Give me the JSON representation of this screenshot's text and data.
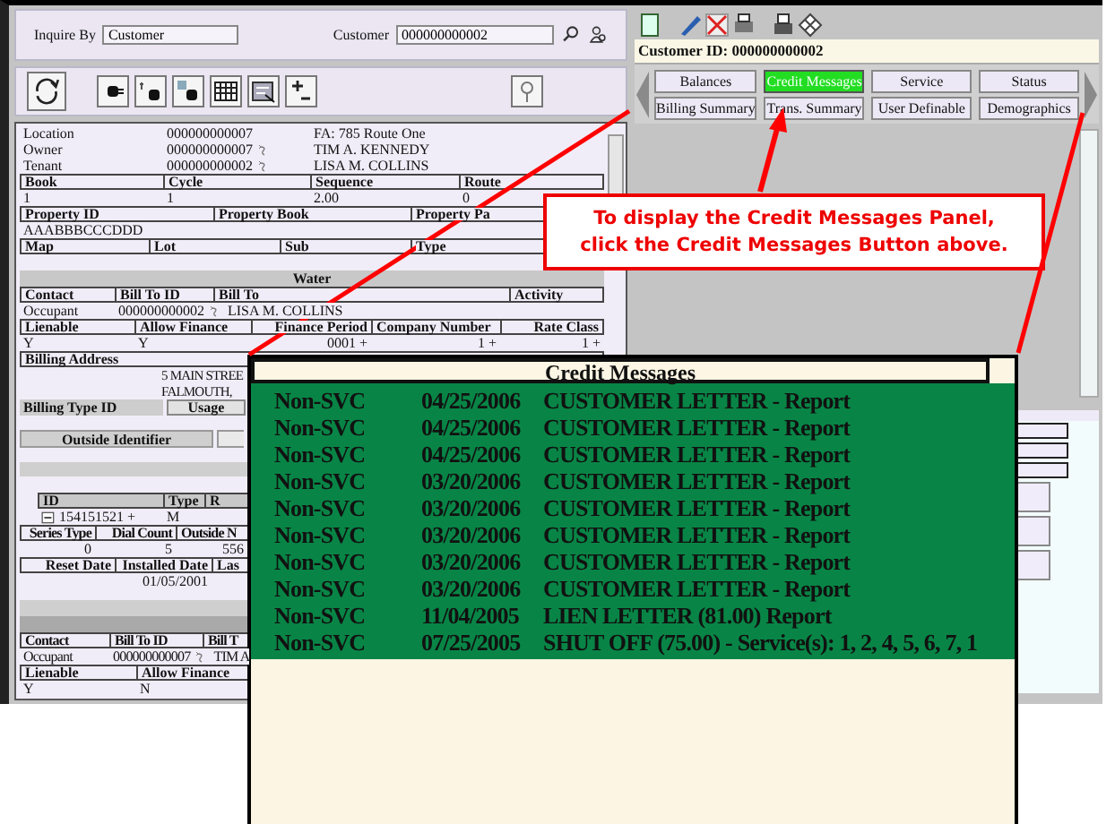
{
  "inquiry": {
    "label": "Inquire By",
    "value": "Customer",
    "customer_label": "Customer",
    "customer_value": "000000000002"
  },
  "left_rows": [
    {
      "kind": "info",
      "cells": [
        {
          "text": "Location"
        },
        {
          "text": "000000000007"
        },
        {
          "text": "FA: 785 Route One"
        }
      ]
    },
    {
      "kind": "info",
      "cells": [
        {
          "text": "Owner"
        },
        {
          "text": "000000000007",
          "kind": "lookup"
        },
        {
          "text": "TIM A. KENNEDY"
        }
      ]
    },
    {
      "kind": "info",
      "cells": [
        {
          "text": "Tenant"
        },
        {
          "text": "000000000002",
          "kind": "lookup"
        },
        {
          "text": "LISA M. COLLINS"
        }
      ]
    },
    {
      "kind": "header",
      "cells": [
        {
          "text": "Book"
        },
        {
          "text": "Cycle"
        },
        {
          "text": "Sequence"
        },
        {
          "text": "Route"
        }
      ]
    },
    {
      "kind": "values",
      "cells": [
        {
          "text": "1"
        },
        {
          "text": "1"
        },
        {
          "text": "2.00"
        },
        {
          "text": "0"
        }
      ]
    },
    {
      "kind": "header",
      "cells": [
        {
          "text": "Property ID"
        },
        {
          "text": "Property Book"
        },
        {
          "text": "Property Pa"
        }
      ]
    },
    {
      "kind": "values",
      "cells": [
        {
          "text": "AAABBBCCCDDD"
        }
      ]
    },
    {
      "kind": "header",
      "cells": [
        {
          "text": "Map"
        },
        {
          "text": "Lot"
        },
        {
          "text": "Sub"
        },
        {
          "text": "Type"
        }
      ]
    },
    {
      "kind": "section",
      "cells": [
        {
          "text": "Water"
        }
      ]
    },
    {
      "kind": "header",
      "cells": [
        {
          "text": "Contact"
        },
        {
          "text": "Bill To ID"
        },
        {
          "text": "Bill To"
        },
        {
          "text": "Activity"
        }
      ]
    },
    {
      "kind": "values",
      "cells": [
        {
          "text": "Occupant"
        },
        {
          "text": "000000000002",
          "kind": "lookup"
        },
        {
          "text": "LISA M. COLLINS"
        }
      ]
    },
    {
      "kind": "header",
      "cells": [
        {
          "text": "Lienable"
        },
        {
          "text": "Allow Finance"
        },
        {
          "text": "Finance Period"
        },
        {
          "text": "Company Number"
        },
        {
          "text": "Rate Class"
        }
      ]
    },
    {
      "kind": "values",
      "cells": [
        {
          "text": "Y"
        },
        {
          "text": "Y"
        },
        {
          "text": "0001 +"
        },
        {
          "text": "1 +"
        },
        {
          "text": "1 +"
        }
      ]
    },
    {
      "kind": "header",
      "cells": [
        {
          "text": "Billing Address"
        }
      ]
    },
    {
      "kind": "address",
      "cells": [
        {
          "text": "5 MAIN STREE"
        },
        {
          "text": "FALMOUTH,"
        }
      ]
    },
    {
      "kind": "labeled",
      "cells": [
        {
          "text": "Billing Type ID"
        },
        {
          "text": "Usage"
        }
      ]
    },
    {
      "kind": "section_left",
      "cells": [
        {
          "text": "Outside Identifier"
        }
      ]
    },
    {
      "kind": "bar"
    },
    {
      "kind": "header",
      "cells": [
        {
          "text": "ID"
        },
        {
          "text": "Type"
        },
        {
          "text": "R"
        }
      ]
    },
    {
      "kind": "values",
      "cells": [
        {
          "text": "154151521 +",
          "kind": "expander"
        },
        {
          "text": "M"
        }
      ]
    },
    {
      "kind": "header",
      "cells": [
        {
          "text": "Series Type"
        },
        {
          "text": "Dial Count"
        },
        {
          "text": "Outside N"
        }
      ]
    },
    {
      "kind": "values",
      "cells": [
        {
          "text": "0"
        },
        {
          "text": "5"
        },
        {
          "text": "556"
        }
      ]
    },
    {
      "kind": "header",
      "cells": [
        {
          "text": "Reset Date"
        },
        {
          "text": "Installed Date"
        },
        {
          "text": "Las"
        }
      ]
    },
    {
      "kind": "values",
      "cells": [
        {
          "text": "01/05/2001"
        }
      ]
    },
    {
      "kind": "bar"
    },
    {
      "kind": "dark_bar"
    },
    {
      "kind": "header",
      "cells": [
        {
          "text": "Contact"
        },
        {
          "text": "Bill To ID"
        },
        {
          "text": "Bill T"
        }
      ]
    },
    {
      "kind": "values",
      "cells": [
        {
          "text": "Occupant"
        },
        {
          "text": "000000000007",
          "kind": "lookup"
        },
        {
          "text": "TIM A"
        }
      ]
    },
    {
      "kind": "header",
      "cells": [
        {
          "text": "Lienable"
        },
        {
          "text": "Allow Finance"
        }
      ]
    },
    {
      "kind": "values",
      "cells": [
        {
          "text": "Y"
        },
        {
          "text": "N"
        }
      ]
    }
  ],
  "right_panel": {
    "customer_id": "Customer ID: 000000000002",
    "tabs": [
      {
        "label": "Balances",
        "selected": false
      },
      {
        "label": "Credit Messages",
        "selected": true
      },
      {
        "label": "Service",
        "selected": false
      },
      {
        "label": "Status",
        "selected": false
      },
      {
        "label": "Billing Summary",
        "selected": false
      },
      {
        "label": "Trans. Summary",
        "selected": false
      },
      {
        "label": "User Definable",
        "selected": false
      },
      {
        "label": "Demographics",
        "selected": false
      }
    ]
  },
  "callout": {
    "lines": [
      "To display the Credit Messages Panel,",
      "click the Credit Messages Button above."
    ]
  },
  "credit_messages": {
    "title": "Credit Messages",
    "rows": [
      {
        "type": "Non-SVC",
        "date": "04/25/2006",
        "description": "CUSTOMER LETTER - Report"
      },
      {
        "type": "Non-SVC",
        "date": "04/25/2006",
        "description": "CUSTOMER LETTER - Report"
      },
      {
        "type": "Non-SVC",
        "date": "04/25/2006",
        "description": "CUSTOMER LETTER - Report"
      },
      {
        "type": "Non-SVC",
        "date": "03/20/2006",
        "description": "CUSTOMER LETTER - Report"
      },
      {
        "type": "Non-SVC",
        "date": "03/20/2006",
        "description": "CUSTOMER LETTER - Report"
      },
      {
        "type": "Non-SVC",
        "date": "03/20/2006",
        "description": "CUSTOMER LETTER - Report"
      },
      {
        "type": "Non-SVC",
        "date": "03/20/2006",
        "description": "CUSTOMER LETTER - Report"
      },
      {
        "type": "Non-SVC",
        "date": "03/20/2006",
        "description": "CUSTOMER LETTER - Report"
      },
      {
        "type": "Non-SVC",
        "date": "11/04/2005",
        "description": "LIEN LETTER (81.00) Report"
      },
      {
        "type": "Non-SVC",
        "date": "07/25/2005",
        "description": "SHUT OFF (75.00) - Service(s): 1, 2, 4, 5, 6, 7, 1"
      }
    ]
  }
}
